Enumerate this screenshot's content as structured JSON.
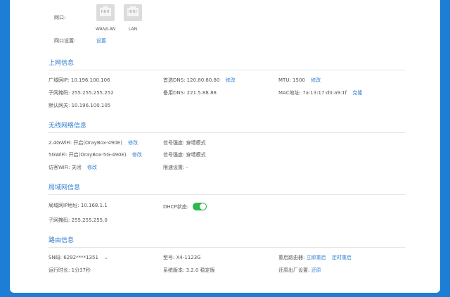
{
  "ports": {
    "label": "网口:",
    "wan_label": "WAN/LAN",
    "lan_label": "LAN",
    "settings_label": "网口设置:",
    "settings_link": "设置"
  },
  "internet": {
    "title": "上网信息",
    "wan_ip_label": "广域网IP:",
    "wan_ip": "10.196.100.106",
    "primary_dns_label": "首选DNS:",
    "primary_dns": "120.80.80.80",
    "primary_dns_edit": "修改",
    "mtu_label": "MTU:",
    "mtu": "1500",
    "mtu_edit": "修改",
    "subnet_label": "子网掩码:",
    "subnet": "255.255.255.252",
    "backup_dns_label": "备用DNS:",
    "backup_dns": "221.5.88.88",
    "mac_label": "MAC地址:",
    "mac": "7a:13:17:d0:a9:1f",
    "mac_clone": "克隆",
    "gateway_label": "默认网关:",
    "gateway": "10.196.100.105"
  },
  "wireless": {
    "title": "无线网络信息",
    "wifi24_label": "2.4GWiFi:",
    "wifi24_value": "开启(OrayBox-490E)",
    "wifi24_edit": "修改",
    "signal1_label": "信号强度:",
    "signal1_value": "穿墙模式",
    "wifi5_label": "5GWiFi:",
    "wifi5_value": "开启(OrayBox-5G-490E)",
    "wifi5_edit": "修改",
    "signal2_label": "信号强度:",
    "signal2_value": "穿墙模式",
    "guest_label": "访客WiFi:",
    "guest_value": "关闭",
    "guest_edit": "修改",
    "speed_label": "限速设置:",
    "speed_value": "-"
  },
  "lan": {
    "title": "局域网信息",
    "ip_label": "局域网IP地址:",
    "ip": "10.168.1.1",
    "dhcp_label": "DHCP状态:",
    "dhcp_on": true,
    "subnet_label": "子网掩码:",
    "subnet": "255.255.255.0"
  },
  "router": {
    "title": "路由信息",
    "sn_label": "SN码:",
    "sn": "6292****1351",
    "model_label": "型号:",
    "model": "X4-1123G",
    "reboot_label": "重启路由器:",
    "reboot_now": "立即重启",
    "reboot_timed": "定时重启",
    "uptime_label": "运行时长:",
    "uptime": "1分37秒",
    "version_label": "系统版本:",
    "version": "3.2.0 稳定版",
    "reset_label": "还原出厂设置:",
    "reset_link": "还原"
  },
  "colors": {
    "background": "#1d7ed6",
    "accent": "#2f7fcf",
    "toggle_on": "#2db84d"
  }
}
